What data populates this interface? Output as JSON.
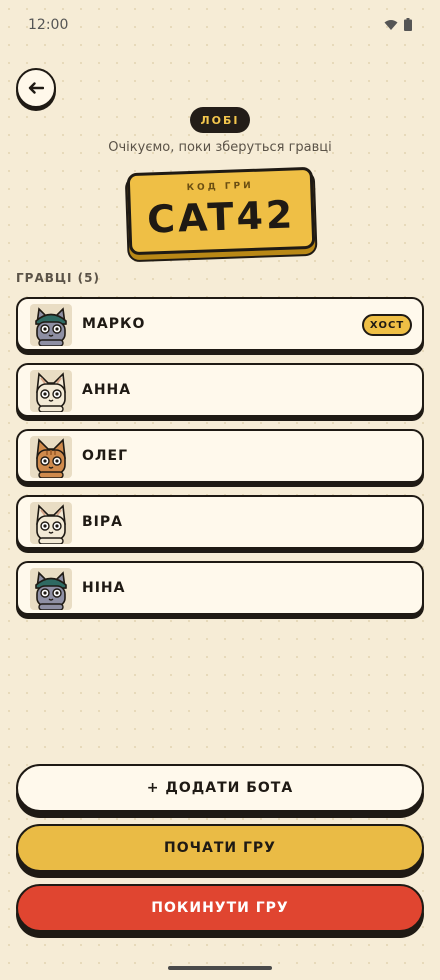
{
  "status_bar": {
    "time": "12:00",
    "icons": [
      "wifi-icon",
      "battery-icon"
    ]
  },
  "header": {
    "back_icon": "arrow-left-icon",
    "badge": "ЛОБІ",
    "subtitle": "Очікуємо, поки зберуться гравці"
  },
  "game_code": {
    "label": "КОД ГРИ",
    "value": "CAT42"
  },
  "players": {
    "heading": "ГРАВЦІ (5)",
    "items": [
      {
        "name": "МАРКО",
        "badge": "ХОСТ",
        "avatar": "cat-gray-beanie-avatar"
      },
      {
        "name": "АННА",
        "avatar": "cat-cream-avatar"
      },
      {
        "name": "ОЛЕГ",
        "avatar": "cat-orange-avatar"
      },
      {
        "name": "ВІРА",
        "avatar": "cat-cream-avatar"
      },
      {
        "name": "НІНА",
        "avatar": "cat-gray-beanie-avatar"
      }
    ]
  },
  "actions": {
    "add_bot": "+ ДОДАТИ БОТА",
    "start_game": "ПОЧАТИ ГРУ",
    "leave_game": "ПОКИНУТИ ГРУ"
  },
  "colors": {
    "background": "#f6ecd6",
    "accent_yellow": "#efbf45",
    "danger_red": "#e04530",
    "ink": "#1f1a14"
  }
}
